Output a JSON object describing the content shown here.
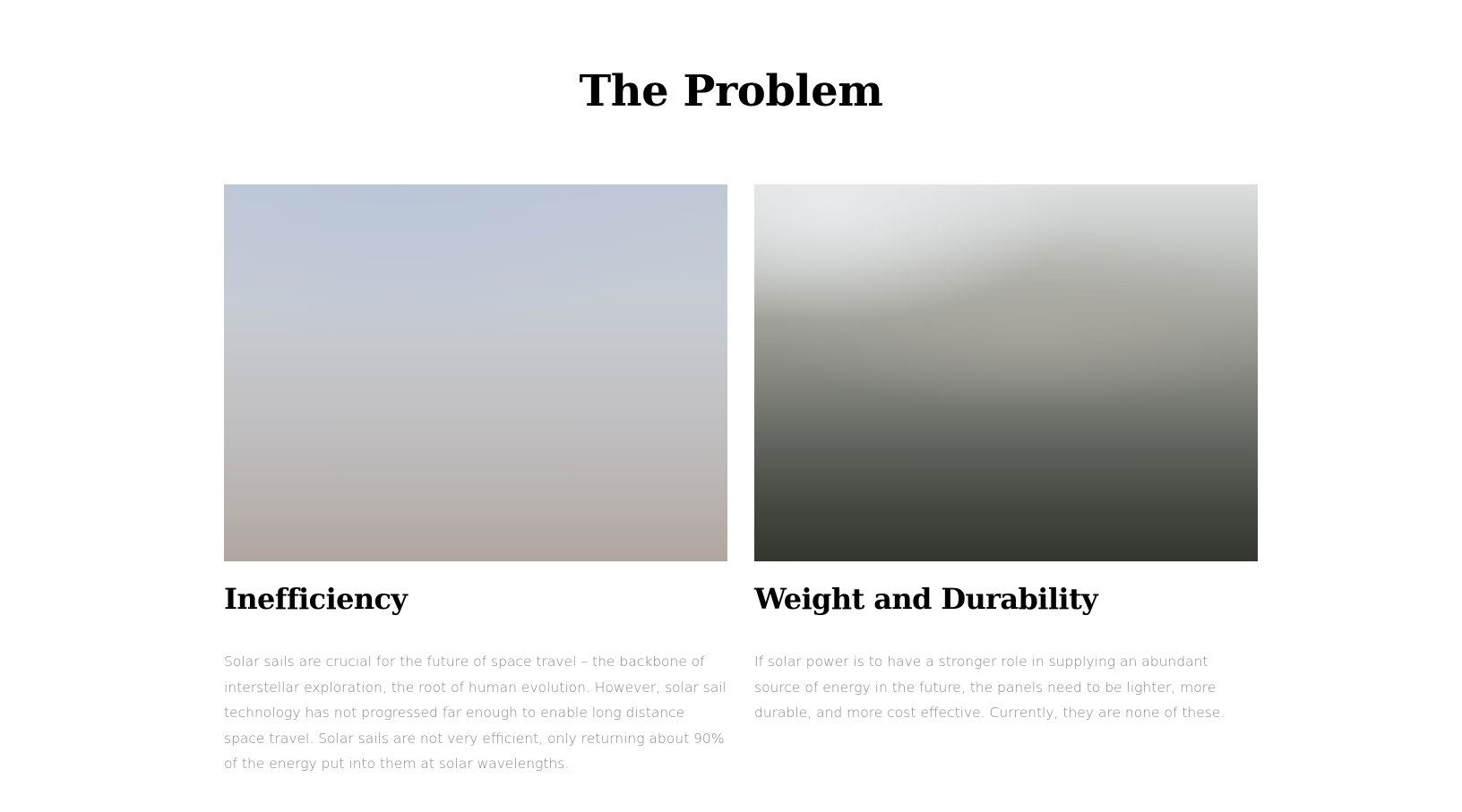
{
  "section": {
    "title": "The Problem"
  },
  "cards": [
    {
      "title": "Inefficiency",
      "image": "sky-gradient-image",
      "text": "Solar sails are crucial for the future of space travel – the backbone of interstellar exploration, the root of human evolution. However, solar sail technology has not progressed far enough to enable long distance space travel. Solar sails are not very efficient, only returning about 90% of the energy put into them at solar wavelengths."
    },
    {
      "title": "Weight and Durability",
      "image": "dark-landscape-image",
      "text": "If solar power is to have a stronger role in supplying an abundant source of energy in the future, the panels need to be lighter, more durable, and more cost effective. Currently, they are none of these."
    }
  ],
  "colors": {
    "heading": "#000000",
    "body_text": "#8a8a8a",
    "background": "#ffffff"
  }
}
